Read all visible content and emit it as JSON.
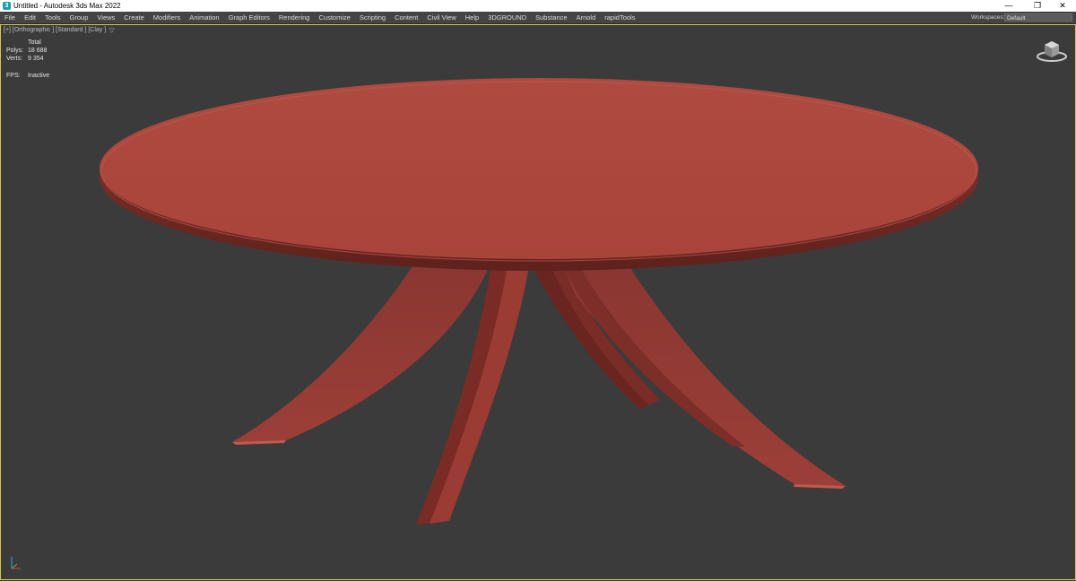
{
  "window": {
    "title": "Untitled - Autodesk 3ds Max 2022",
    "app_icon_glyph": "3",
    "minimize_glyph": "—",
    "restore_glyph": "❐",
    "close_glyph": "✕"
  },
  "menu": {
    "items": [
      "File",
      "Edit",
      "Tools",
      "Group",
      "Views",
      "Create",
      "Modifiers",
      "Animation",
      "Graph Editors",
      "Rendering",
      "Customize",
      "Scripting",
      "Content",
      "Civil View",
      "Help",
      "3DGROUND",
      "Substance",
      "Arnold",
      "rapidTools"
    ],
    "workspaces_label": "Workspaces:",
    "workspaces_value": "Default"
  },
  "viewport": {
    "label": "[+] [Orthographic ] [Standard ] [Clay ]",
    "filter_glyph": "▽",
    "stats": {
      "total_label": "Total",
      "polys_label": "Polys:",
      "polys_value": "18 688",
      "verts_label": "Verts:",
      "verts_value": "9 354",
      "fps_label": "FPS:",
      "fps_value": "Inactive"
    },
    "clay_color": "#b04a42",
    "border_color": "#d6c64a"
  },
  "icons": {
    "viewcube": "viewcube-icon",
    "axis": "axis-gizmo-icon"
  }
}
